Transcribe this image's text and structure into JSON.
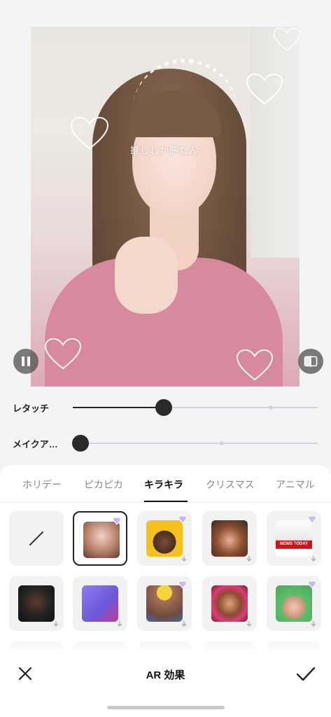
{
  "preview": {
    "sticker_text": "推ししか勝たん"
  },
  "sliders": [
    {
      "label": "レタッチ",
      "value": 0.37
    },
    {
      "label": "メイクア…",
      "value": 0.03
    }
  ],
  "tabs": [
    {
      "label": "ホリデー",
      "active": false
    },
    {
      "label": "ピカピカ",
      "active": false
    },
    {
      "label": "キラキラ",
      "active": true
    },
    {
      "label": "クリスマス",
      "active": false
    },
    {
      "label": "アニマル",
      "active": false
    }
  ],
  "effects": {
    "news_label": "NEWS TODAY"
  },
  "bottom_bar": {
    "title": "AR 効果"
  },
  "colors": {
    "accent": "#222222",
    "preview_pink": "#d9899d"
  }
}
